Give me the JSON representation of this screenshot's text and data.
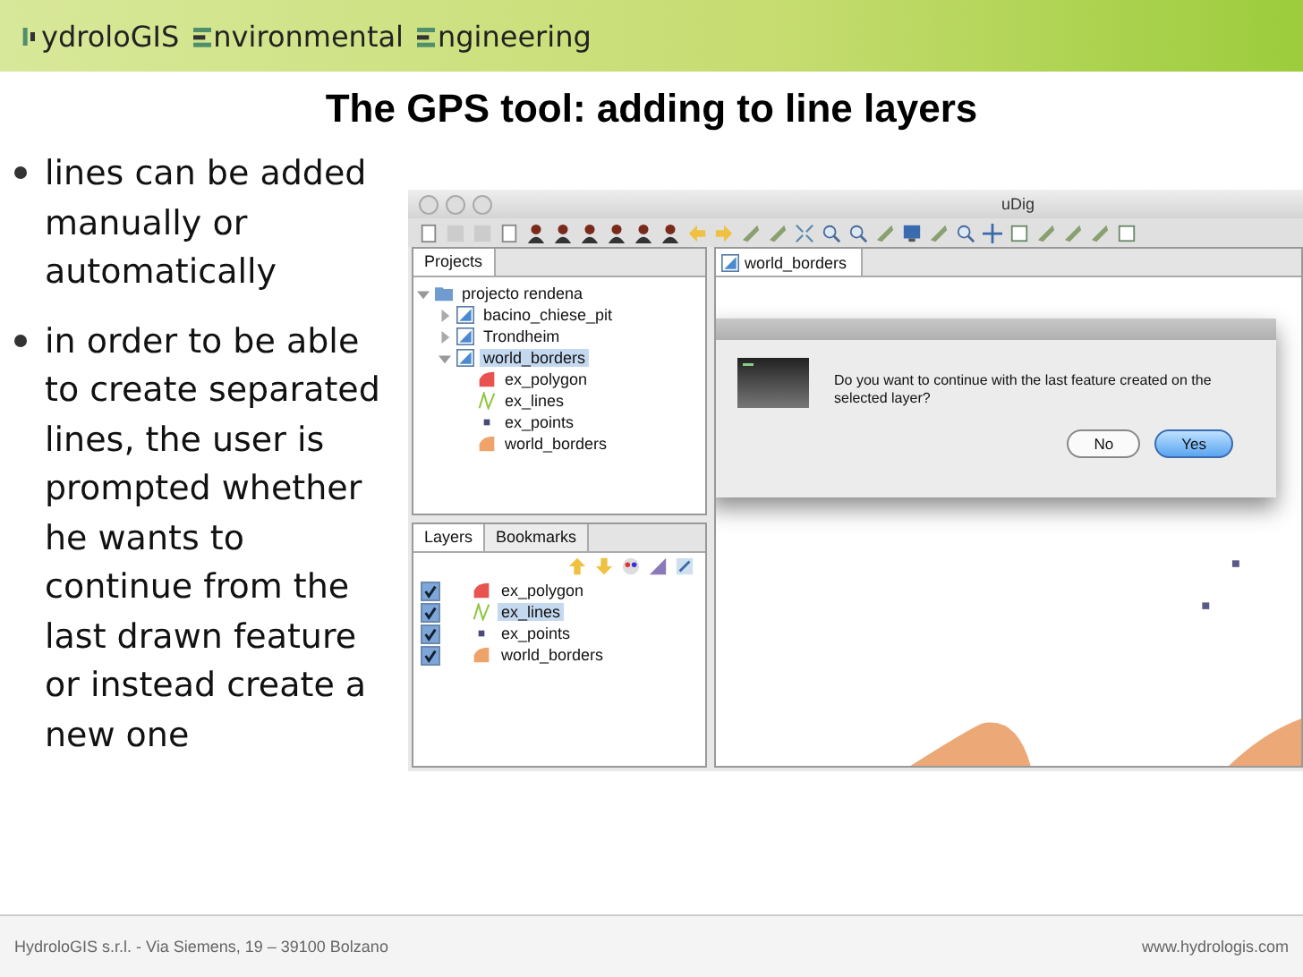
{
  "header": {
    "logo_parts": [
      "ydroloGIS",
      "nvironmental",
      "ngineering"
    ]
  },
  "title": "The GPS tool: adding to line layers",
  "bullets": [
    "lines can be added manually or automatically",
    "in order to be able to create separated lines, the user is prompted whether he wants to continue from the last drawn feature or instead create a new one"
  ],
  "app": {
    "window": {
      "title": "uDig"
    },
    "projects": {
      "tab": "Projects",
      "tree": [
        {
          "label": "projecto rendena",
          "kind": "project",
          "expanded": true,
          "selected": false,
          "children": [
            {
              "label": "bacino_chiese_pit",
              "kind": "map",
              "expanded": false,
              "selected": false
            },
            {
              "label": "Trondheim",
              "kind": "map",
              "expanded": false,
              "selected": false
            },
            {
              "label": "world_borders",
              "kind": "map",
              "expanded": true,
              "selected": true,
              "children": [
                {
                  "label": "ex_polygon",
                  "kind": "polygon",
                  "color": "#e8524f",
                  "selected": false
                },
                {
                  "label": "ex_lines",
                  "kind": "line",
                  "color": "#8cc63f",
                  "selected": false
                },
                {
                  "label": "ex_points",
                  "kind": "point",
                  "color": "#4a4a7a",
                  "selected": false
                },
                {
                  "label": "world_borders",
                  "kind": "polygon",
                  "color": "#eea36b",
                  "selected": false
                }
              ]
            }
          ]
        }
      ]
    },
    "layers": {
      "tabs": [
        {
          "label": "Layers",
          "selected": true
        },
        {
          "label": "Bookmarks",
          "selected": false
        }
      ],
      "items": [
        {
          "label": "ex_polygon",
          "kind": "polygon",
          "color": "#e8524f",
          "checked": true,
          "selected": false
        },
        {
          "label": "ex_lines",
          "kind": "line",
          "color": "#8cc63f",
          "checked": true,
          "selected": true
        },
        {
          "label": "ex_points",
          "kind": "point",
          "color": "#4a4a7a",
          "checked": true,
          "selected": false
        },
        {
          "label": "world_borders",
          "kind": "polygon",
          "color": "#eea36b",
          "checked": true,
          "selected": false
        }
      ]
    },
    "editor": {
      "tab": "world_borders"
    },
    "dialog": {
      "message": "Do you want to continue with the last feature created on the selected layer?",
      "buttons": [
        {
          "label": "No",
          "selected": false
        },
        {
          "label": "Yes",
          "selected": true
        }
      ]
    }
  },
  "footer": {
    "address": "HydroloGIS s.r.l. - Via Siemens, 19 – 39100 Bolzano",
    "website": "www.hydrologis.com"
  }
}
